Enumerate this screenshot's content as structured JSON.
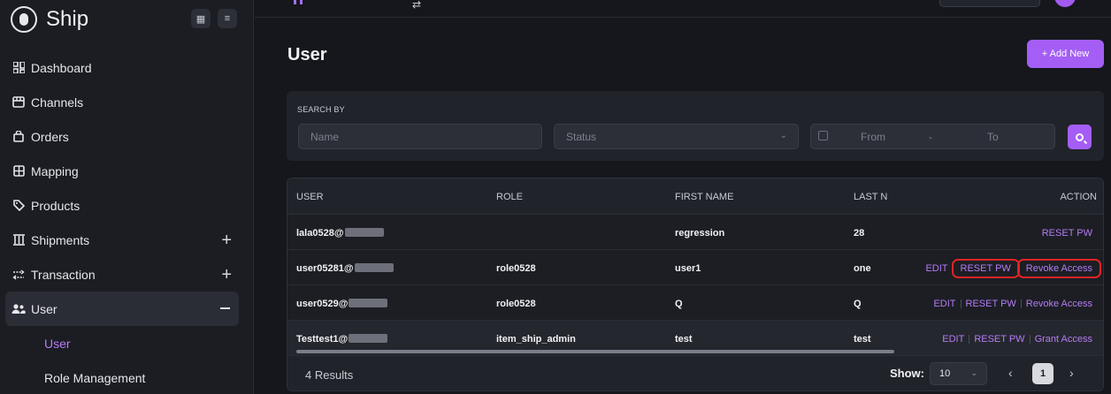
{
  "brand": {
    "name": "Ship"
  },
  "sidebar": {
    "items": [
      {
        "label": "Dashboard",
        "icon": "dashboard-icon"
      },
      {
        "label": "Channels",
        "icon": "store-icon"
      },
      {
        "label": "Orders",
        "icon": "bag-icon"
      },
      {
        "label": "Mapping",
        "icon": "map-grid-icon"
      },
      {
        "label": "Products",
        "icon": "tag-icon"
      },
      {
        "label": "Shipments",
        "icon": "columns-icon",
        "expand": "+"
      },
      {
        "label": "Transaction",
        "icon": "swap-icon",
        "expand": "+"
      },
      {
        "label": "User",
        "icon": "users-icon",
        "expand": "–"
      }
    ],
    "sub_items": [
      {
        "label": "User"
      },
      {
        "label": "Role Management"
      }
    ]
  },
  "page": {
    "title": "User",
    "add_button": "+ Add New"
  },
  "search": {
    "label": "SEARCH BY",
    "name_placeholder": "Name",
    "status_placeholder": "Status",
    "from_placeholder": "From",
    "dash": "-",
    "to_placeholder": "To"
  },
  "table": {
    "columns": [
      "USER",
      "ROLE",
      "FIRST NAME",
      "LAST N",
      "ACTION"
    ],
    "rows": [
      {
        "user": "lala0528@",
        "role": "",
        "first_name": "regression",
        "last_name": "28",
        "actions": [
          "RESET PW"
        ]
      },
      {
        "user": "user05281@",
        "role": "role0528",
        "first_name": "user1",
        "last_name": "one",
        "actions": [
          "EDIT",
          "RESET PW",
          "Revoke Access"
        ]
      },
      {
        "user": "user0529@",
        "role": "role0528",
        "first_name": "Q",
        "last_name": "Q",
        "actions": [
          "EDIT",
          "RESET PW",
          "Revoke Access"
        ]
      },
      {
        "user": "Testtest1@",
        "role": "item_ship_admin",
        "first_name": "test",
        "last_name": "test",
        "actions": [
          "EDIT",
          "RESET PW",
          "Grant Access"
        ]
      }
    ]
  },
  "footer": {
    "results": "4 Results",
    "show_label": "Show:",
    "page_size": "10",
    "prev": "‹",
    "current_page": "1",
    "next": "›"
  },
  "colors": {
    "accent": "#a45ef5",
    "highlight_box": "#e02424",
    "background": "#15171c"
  }
}
